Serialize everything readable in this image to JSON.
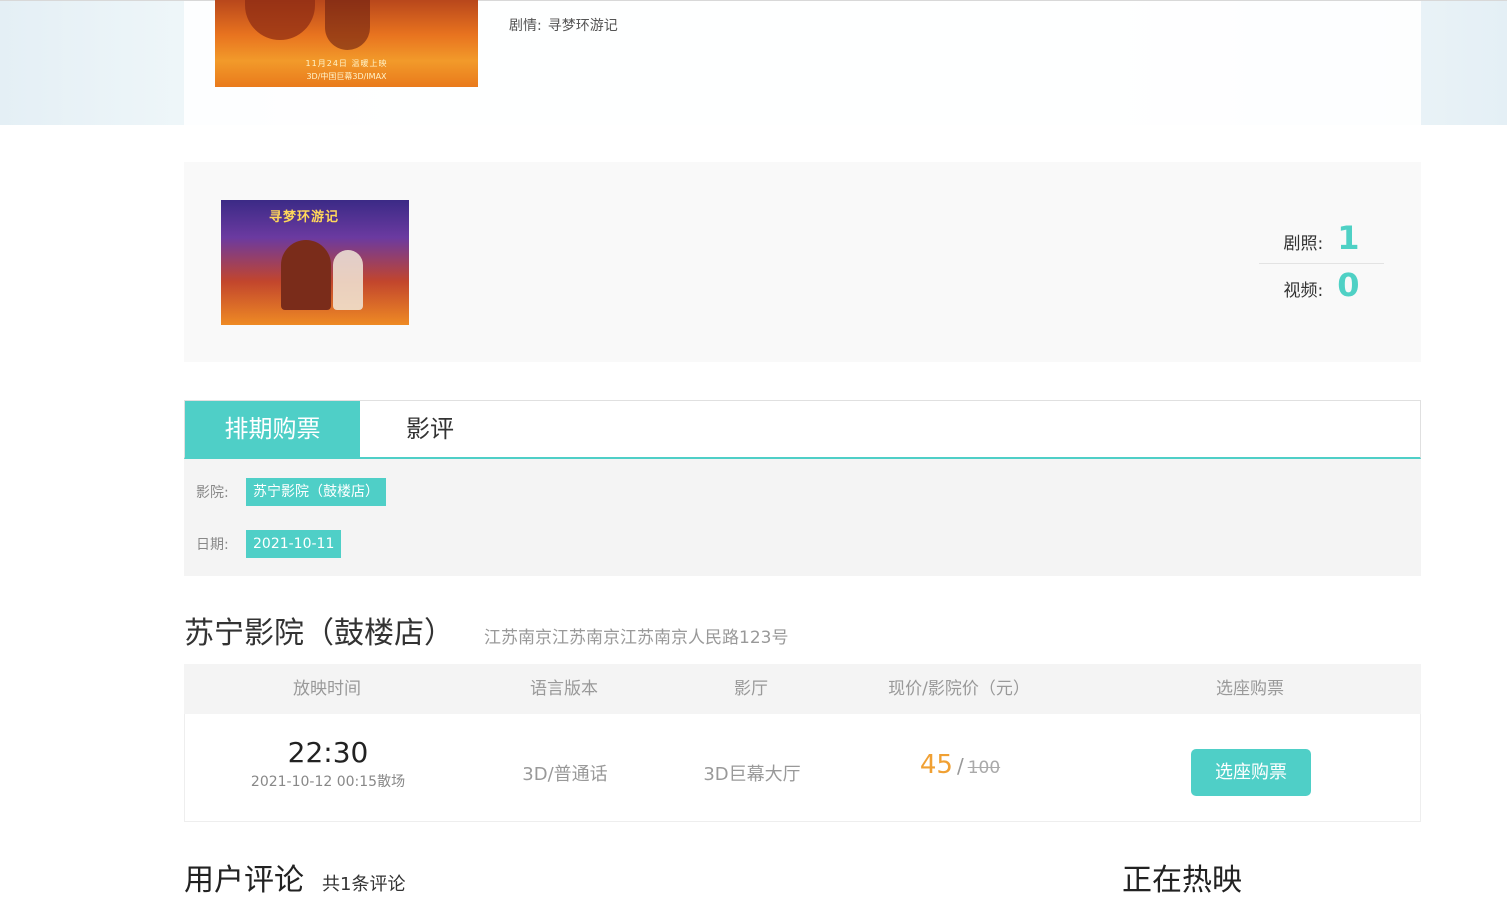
{
  "banner": {
    "poster_caption": "11月24日 温暖上映",
    "poster_formats": "3D/中国巨幕3D/IMAX",
    "plot_label": "剧情:",
    "plot_value": "寻梦环游记"
  },
  "gallery": {
    "thumb_title": "寻梦环游记",
    "stats": [
      {
        "label": "剧照:",
        "value": "1"
      },
      {
        "label": "视频:",
        "value": "0"
      }
    ]
  },
  "tabs": [
    {
      "label": "排期购票",
      "active": true
    },
    {
      "label": "影评",
      "active": false
    }
  ],
  "filters": {
    "cinema_label": "影院:",
    "cinema_value": "苏宁影院（鼓楼店）",
    "date_label": "日期:",
    "date_value": "2021-10-11"
  },
  "cinema": {
    "name": "苏宁影院（鼓楼店）",
    "address": "江苏南京江苏南京江苏南京人民路123号"
  },
  "schedule": {
    "headers": [
      "放映时间",
      "语言版本",
      "影厅",
      "现价/影院价（元）",
      "选座购票"
    ],
    "rows": [
      {
        "start": "22:30",
        "end": "2021-10-12 00:15散场",
        "language": "3D/普通话",
        "hall": "3D巨幕大厅",
        "price_now": "45",
        "price_sep": "/",
        "price_old": "100",
        "buy_label": "选座购票"
      }
    ]
  },
  "reviews": {
    "title": "用户评论",
    "count": "共1条评论"
  },
  "now_showing": "正在热映",
  "colors": {
    "accent": "#4fcfc7",
    "price": "#f0a033"
  }
}
